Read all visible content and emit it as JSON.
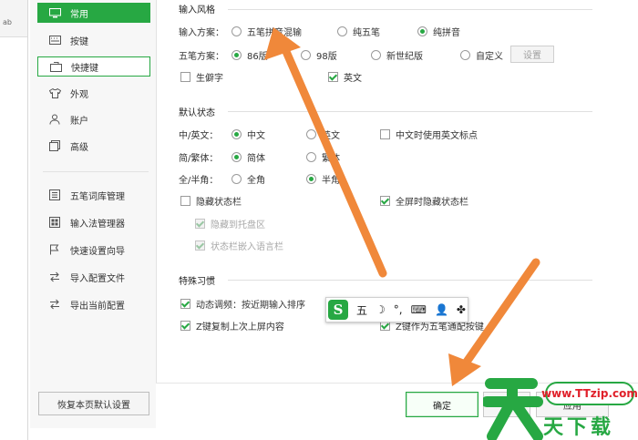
{
  "background_app": {
    "toolbar_fragment": "ab"
  },
  "sidebar": {
    "items": [
      {
        "label": "常用",
        "icon": "monitor-icon",
        "state": "active"
      },
      {
        "label": "按键",
        "icon": "keyboard-icon",
        "state": "normal"
      },
      {
        "label": "快捷键",
        "icon": "shortcut-icon",
        "state": "selected"
      },
      {
        "label": "外观",
        "icon": "shirt-icon",
        "state": "normal"
      },
      {
        "label": "账户",
        "icon": "user-icon",
        "state": "normal"
      },
      {
        "label": "高级",
        "icon": "advanced-icon",
        "state": "normal"
      }
    ],
    "tools": [
      {
        "label": "五笔词库管理",
        "icon": "dictionary-icon"
      },
      {
        "label": "输入法管理器",
        "icon": "manager-icon"
      },
      {
        "label": "快速设置向导",
        "icon": "flag-icon"
      },
      {
        "label": "导入配置文件",
        "icon": "import-icon"
      },
      {
        "label": "导出当前配置",
        "icon": "export-icon"
      }
    ],
    "reset_label": "恢复本页默认设置"
  },
  "input_style": {
    "section_title": "输入风格",
    "scheme_label": "输入方案：",
    "scheme_options": [
      "五笔拼音混输",
      "纯五笔",
      "纯拼音"
    ],
    "scheme_selected": "纯拼音",
    "wubi_label": "五笔方案：",
    "wubi_options": [
      "86版",
      "98版",
      "新世纪版",
      "自定义"
    ],
    "wubi_selected": "86版",
    "settings_button": "设置",
    "rare_chars_label": "生僻字",
    "rare_chars_checked": false,
    "english_label": "英文",
    "english_checked": true
  },
  "default_state": {
    "section_title": "默认状态",
    "cn_en_label": "中/英文：",
    "cn_en_options": [
      "中文",
      "英文"
    ],
    "cn_en_selected": "中文",
    "cn_en_punct_label": "中文时使用英文标点",
    "cn_en_punct_checked": false,
    "simp_trad_label": "简/繁体：",
    "simp_trad_options": [
      "简体",
      "繁体"
    ],
    "simp_trad_selected": "简体",
    "width_label": "全/半角：",
    "width_options": [
      "全角",
      "半角"
    ],
    "width_selected": "半角",
    "hide_status_label": "隐藏状态栏",
    "hide_status_checked": false,
    "fullscreen_hide_label": "全屏时隐藏状态栏",
    "fullscreen_hide_checked": true,
    "tray_label": "隐藏到托盘区",
    "tray_checked": true,
    "lang_bar_label": "状态栏嵌入语言栏",
    "lang_bar_checked": true
  },
  "special_habits": {
    "section_title": "特殊习惯",
    "dynamic_freq_label": "动态调频：按近期输入排序",
    "dynamic_freq_checked": true,
    "z_copy_label": "Z键复制上次上屏内容",
    "z_copy_checked": true,
    "z_wildcard_label": "Z键作为五笔通配按键",
    "z_wildcard_checked": true
  },
  "ime_toolbar": {
    "logo": "S",
    "items": [
      {
        "glyph": "五",
        "icon": "wubi-mode-icon"
      },
      {
        "glyph": "☽",
        "icon": "moon-icon"
      },
      {
        "glyph": "°,",
        "icon": "punctuation-icon"
      },
      {
        "glyph": "⌨",
        "icon": "keyboard-icon"
      },
      {
        "glyph": "👤",
        "icon": "user-icon"
      },
      {
        "glyph": "✤",
        "icon": "skin-icon"
      }
    ]
  },
  "buttons": {
    "ok": "确定",
    "cancel": "取",
    "apply": "应用"
  },
  "watermark": {
    "url": "www.TTzip.com",
    "brand": "天下载"
  },
  "colors": {
    "accent": "#27a843",
    "arrow": "#f0883a"
  }
}
